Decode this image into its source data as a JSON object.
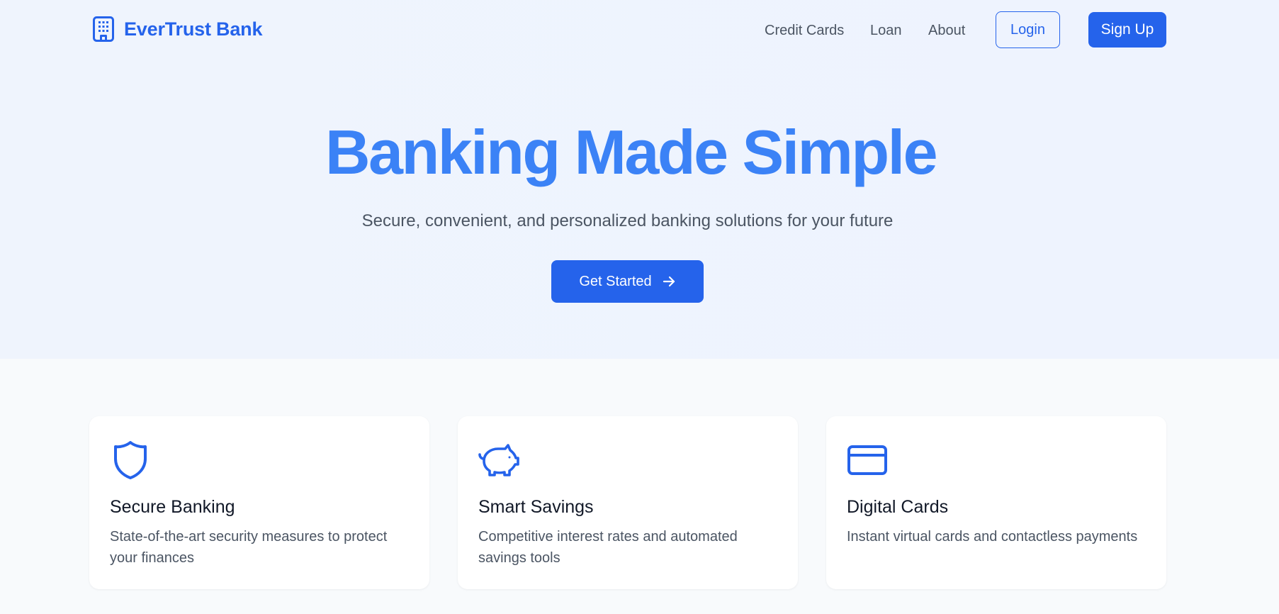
{
  "brand": {
    "name": "EverTrust Bank",
    "icon": "building-icon"
  },
  "nav": {
    "links": [
      "Credit Cards",
      "Loan",
      "About"
    ],
    "login_label": "Login",
    "signup_label": "Sign Up"
  },
  "hero": {
    "title": "Banking Made Simple",
    "subtitle": "Secure, convenient, and personalized banking solutions for your future",
    "cta_label": "Get Started",
    "cta_icon": "arrow-right-icon"
  },
  "features": [
    {
      "icon": "shield-icon",
      "title": "Secure Banking",
      "description": "State-of-the-art security measures to protect your finances"
    },
    {
      "icon": "piggy-bank-icon",
      "title": "Smart Savings",
      "description": "Competitive interest rates and automated savings tools"
    },
    {
      "icon": "credit-card-icon",
      "title": "Digital Cards",
      "description": "Instant virtual cards and contactless payments"
    }
  ],
  "colors": {
    "accent": "#2563eb",
    "hero_title": "#3b82f6",
    "text_muted": "#4b5563",
    "hero_background": "#eef3fe",
    "page_background": "#f8fafc"
  }
}
